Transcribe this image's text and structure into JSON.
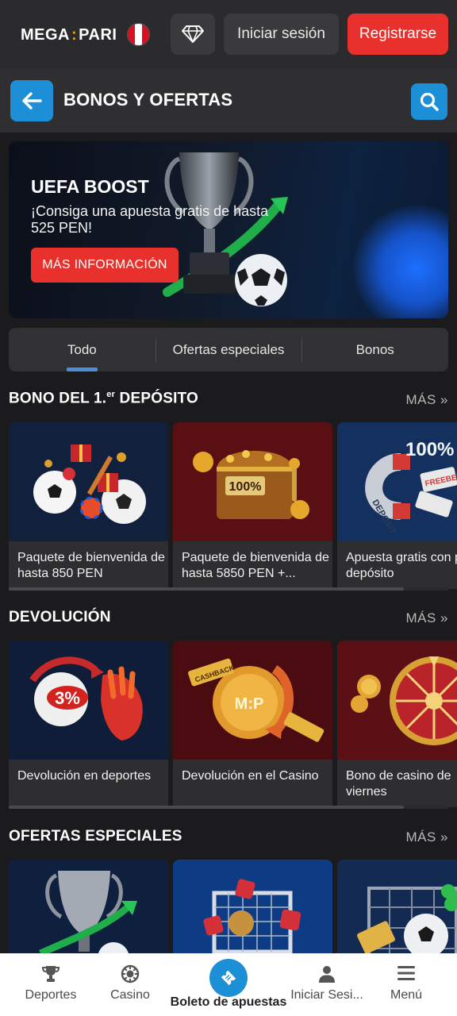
{
  "header": {
    "logo_left": "MEGA",
    "logo_colon": ":",
    "logo_right": "PARI",
    "login_label": "Iniciar sesión",
    "register_label": "Registrarse"
  },
  "titlebar": {
    "title": "BONOS Y OFERTAS"
  },
  "banner": {
    "title": "UEFA BOOST",
    "text": "¡Consiga una apuesta gratis de hasta 525 PEN!",
    "button": "MÁS INFORMACIÓN"
  },
  "tabs": [
    {
      "label": "Todo",
      "active": true
    },
    {
      "label": "Ofertas especiales",
      "active": false
    },
    {
      "label": "Bonos",
      "active": false
    }
  ],
  "sections": [
    {
      "title": "BONO DEL 1.",
      "title_sup": "er",
      "title_rest": " DEPÓSITO",
      "more": "MÁS »",
      "cards": [
        {
          "text": "Paquete de bienvenida de hasta 850 PEN"
        },
        {
          "text": "Paquete de bienvenida de hasta 5850 PEN +..."
        },
        {
          "text": "Apuesta gratis con primer depósito"
        }
      ]
    },
    {
      "title": "DEVOLUCIÓN",
      "more": "MÁS »",
      "cards": [
        {
          "text": "Devolución en deportes"
        },
        {
          "text": "Devolución en el Casino"
        },
        {
          "text": "Bono de casino de viernes"
        }
      ]
    },
    {
      "title": "OFERTAS ESPECIALES",
      "more": "MÁS »",
      "cards": [
        {
          "text": ""
        },
        {
          "text": ""
        },
        {
          "text": ""
        }
      ]
    }
  ],
  "art_text": {
    "chest_badge": "100%",
    "percent_badge": "3%",
    "magnet_badge": "100%",
    "magnet_label": "DEPOSIT",
    "freebet": "FREEBET",
    "cashback": "CASHBACK",
    "coin_mark": "M:P"
  },
  "bottom_nav": [
    {
      "label": "Deportes",
      "icon": "trophy-icon"
    },
    {
      "label": "Casino",
      "icon": "casino-chip-icon"
    },
    {
      "label": "Boleto de apuestas",
      "icon": "ticket-icon"
    },
    {
      "label": "Iniciar Sesi...",
      "icon": "user-icon"
    },
    {
      "label": "Menú",
      "icon": "menu-icon"
    }
  ],
  "colors": {
    "accent_red": "#e8302c",
    "accent_blue": "#1d8fd6",
    "background": "#1b1b1d",
    "logo_colon": "#f2a20a"
  }
}
